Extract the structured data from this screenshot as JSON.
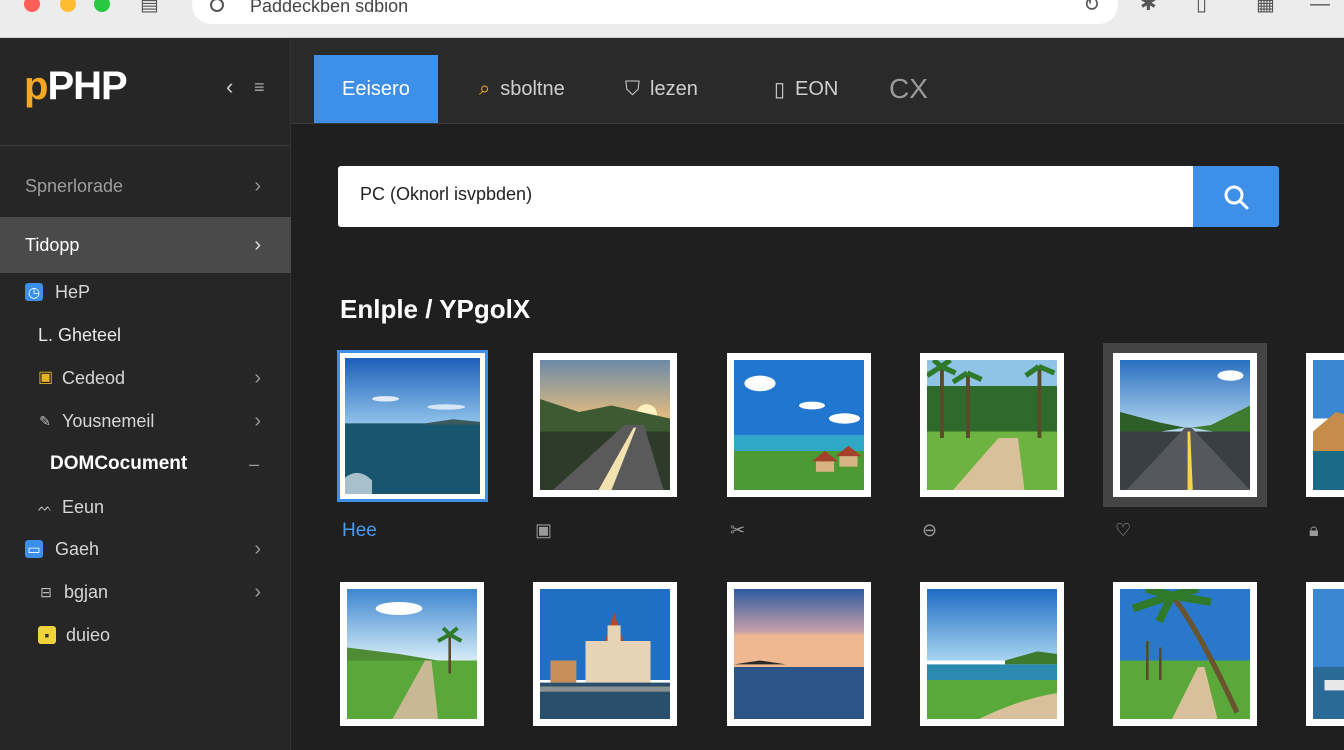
{
  "browser": {
    "url": "Paddeckben sdbion",
    "icons": [
      "sidebar-icon",
      "extensions-icon",
      "bookmark-icon",
      "reader-icon",
      "menu-icon"
    ]
  },
  "sidebar": {
    "logo_p": "p",
    "logo_rest": "PHP",
    "items": [
      {
        "label": "Spnerlorade"
      },
      {
        "label": "Tidopp"
      },
      {
        "label": "HeP"
      },
      {
        "label": "L. Gheteel"
      },
      {
        "label": "Cedeod"
      },
      {
        "label": "Yousnemeil"
      },
      {
        "label": "DOMCocument"
      },
      {
        "label": "Eeun"
      },
      {
        "label": "Gaeh"
      },
      {
        "label": "bgjan"
      },
      {
        "label": "duieo"
      }
    ]
  },
  "tabs": [
    {
      "label": "Eeisero"
    },
    {
      "label": "sboltne"
    },
    {
      "label": "lezen"
    },
    {
      "label": "EON"
    },
    {
      "label": "CX"
    }
  ],
  "search": {
    "value": "PC (Oknorl isvpbden)"
  },
  "section_title": "Enlple / YPgolX",
  "gallery": {
    "first_caption": "Hee",
    "caption_icons": [
      "camera-icon",
      "scissors-icon",
      "tag-icon",
      "heart-icon",
      "lock-icon"
    ]
  },
  "colors": {
    "accent": "#3d8fe8",
    "logo": "#f5a623",
    "sidebar_bg": "#262626",
    "content_bg": "#1f1f1f"
  }
}
